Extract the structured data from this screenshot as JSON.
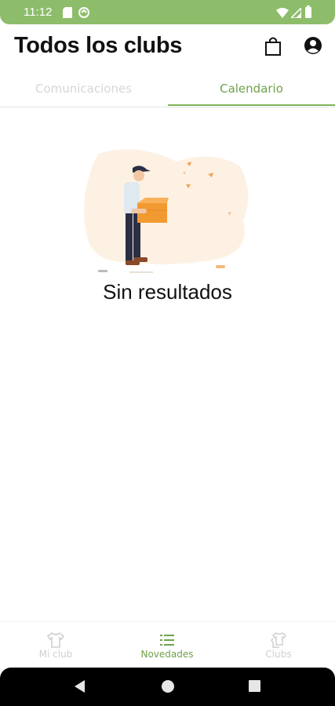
{
  "status_bar": {
    "time": "11:12",
    "background": "#8dbd6a",
    "left_icons": [
      "sd-card-icon",
      "sync-icon"
    ],
    "right_icons": [
      "wifi-icon",
      "signal-icon",
      "battery-icon"
    ]
  },
  "header": {
    "title": "Todos los clubs",
    "actions": [
      "shopping-bag-icon",
      "account-icon"
    ]
  },
  "tabs": [
    {
      "label": "Comunicaciones",
      "selected": false
    },
    {
      "label": "Calendario",
      "selected": true
    }
  ],
  "accent_color": "#6ea24a",
  "empty_state": {
    "illustration": "person-holding-box-illustration",
    "message": "Sin resultados"
  },
  "bottom_nav": [
    {
      "label": "Mi club",
      "icon": "shirt-icon",
      "selected": false
    },
    {
      "label": "Novedades",
      "icon": "list-icon",
      "selected": true
    },
    {
      "label": "Clubs",
      "icon": "shirts-icon",
      "selected": false
    }
  ],
  "system_nav": [
    "back-icon",
    "home-icon",
    "recents-icon"
  ]
}
